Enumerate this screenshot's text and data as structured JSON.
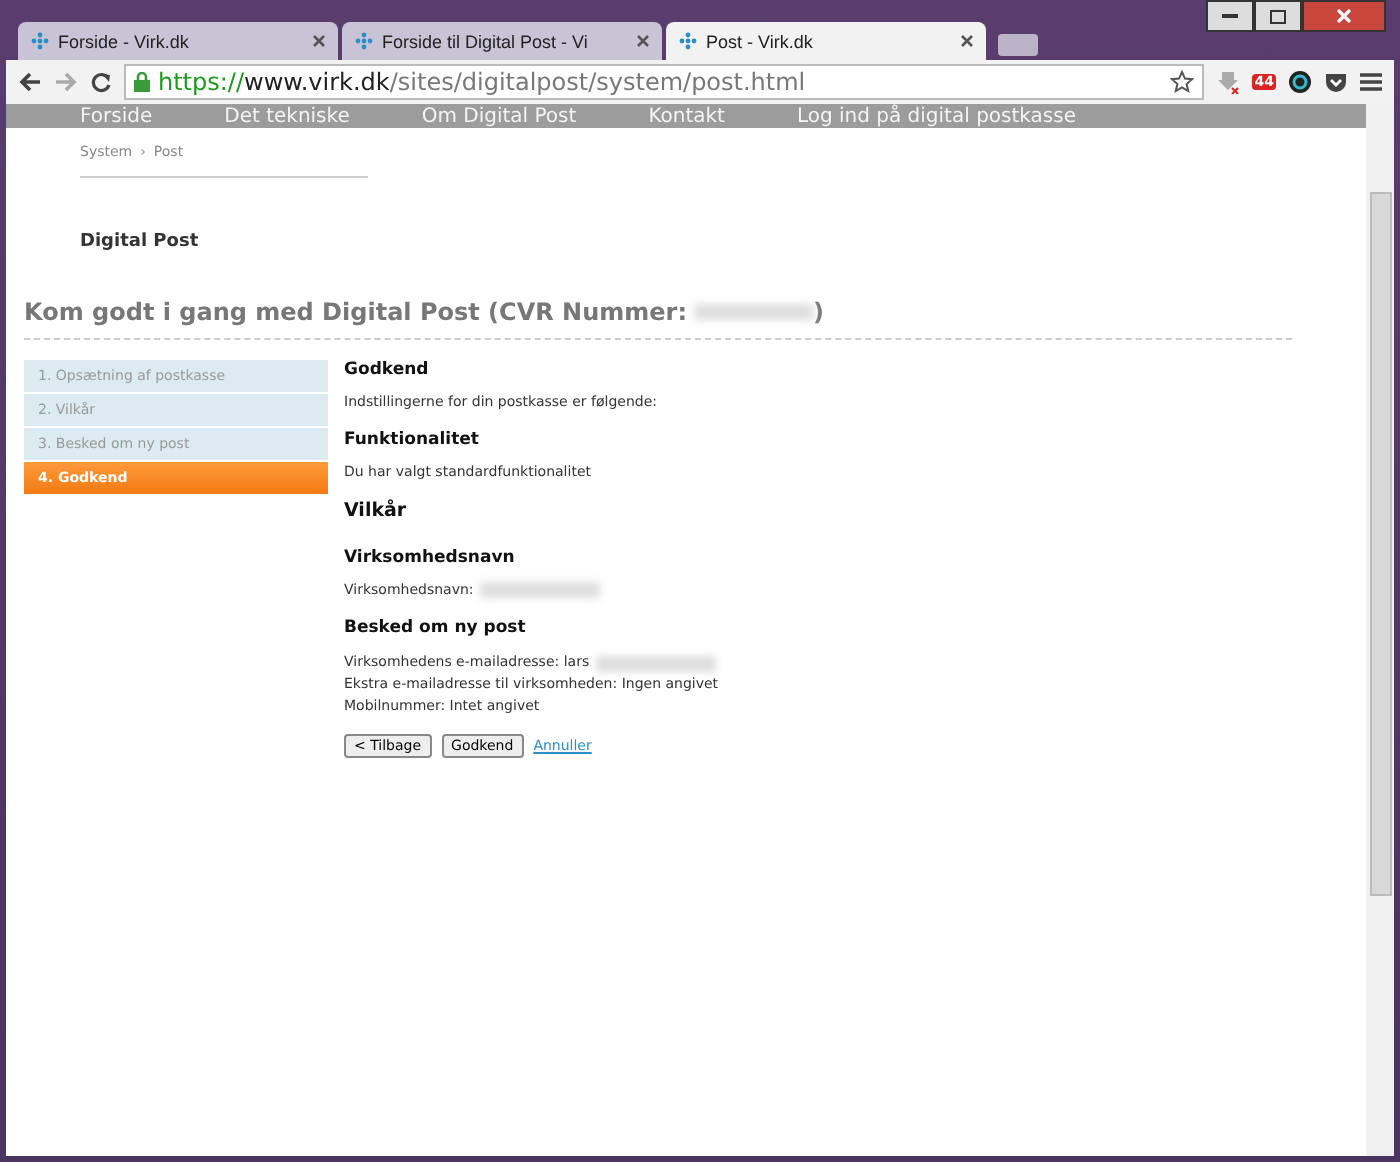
{
  "browser": {
    "tabs": [
      {
        "title": "Forside - Virk.dk",
        "selected": false
      },
      {
        "title": "Forside til Digital Post - Vi",
        "selected": false
      },
      {
        "title": "Post - Virk.dk",
        "selected": true
      }
    ],
    "url": {
      "scheme": "https://",
      "host": "www.virk.dk",
      "path": "/sites/digitalpost/system/post.html"
    },
    "extension_badge": "44"
  },
  "nav": [
    "Forside",
    "Det tekniske",
    "Om Digital Post",
    "Kontakt",
    "Log ind på digital postkasse"
  ],
  "breadcrumb": [
    "System",
    "Post"
  ],
  "breadcrumb_separator": "›",
  "page_title": "Digital Post",
  "heading": "Kom godt i gang med Digital Post (CVR Nummer:",
  "heading_end": ")",
  "steps": [
    {
      "label": "1. Opsætning af postkasse",
      "selected": false
    },
    {
      "label": "2. Vilkår",
      "selected": false
    },
    {
      "label": "3. Besked om ny post",
      "selected": false
    },
    {
      "label": "4. Godkend",
      "selected": true
    }
  ],
  "content": [
    {
      "kind": "h",
      "text": "Godkend"
    },
    {
      "kind": "p",
      "text": "Indstillingerne for din postkasse er følgende:"
    },
    {
      "kind": "h",
      "text": "Funktionalitet"
    },
    {
      "kind": "p",
      "text": "Du har valgt standardfunktionalitet"
    },
    {
      "kind": "h2",
      "text": "Vilkår"
    },
    {
      "kind": "h",
      "text": "Virksomhedsnavn"
    },
    {
      "kind": "p",
      "text": "Virksomhedsnavn:",
      "redacted": true
    },
    {
      "kind": "h",
      "text": "Besked om ny post"
    },
    {
      "kind": "lines",
      "lines": [
        {
          "text": "Virksomhedens e-mailadresse: lars",
          "redacted": true
        },
        {
          "text": "Ekstra e-mailadresse til virksomheden: Ingen angivet"
        },
        {
          "text": "Mobilnummer: Intet angivet"
        }
      ]
    }
  ],
  "buttons": [
    "< Tilbage",
    "Godkend"
  ],
  "cancel_link": "Annuller"
}
